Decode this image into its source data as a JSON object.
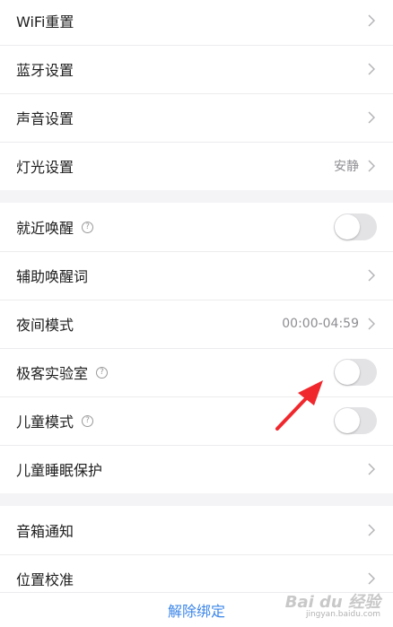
{
  "groups": [
    {
      "items": [
        {
          "label": "WiFi重置",
          "type": "link"
        },
        {
          "label": "蓝牙设置",
          "type": "link"
        },
        {
          "label": "声音设置",
          "type": "link"
        },
        {
          "label": "灯光设置",
          "type": "link",
          "value": "安静"
        }
      ]
    },
    {
      "items": [
        {
          "label": "就近唤醒",
          "type": "toggle",
          "help": true,
          "on": false
        },
        {
          "label": "辅助唤醒词",
          "type": "link"
        },
        {
          "label": "夜间模式",
          "type": "link",
          "value": "00:00-04:59"
        },
        {
          "label": "极客实验室",
          "type": "toggle",
          "help": true,
          "on": false
        },
        {
          "label": "儿童模式",
          "type": "toggle",
          "help": true,
          "on": false
        },
        {
          "label": "儿童睡眠保护",
          "type": "link"
        }
      ]
    },
    {
      "items": [
        {
          "label": "音箱通知",
          "type": "link"
        },
        {
          "label": "位置校准",
          "type": "link"
        }
      ]
    }
  ],
  "help_glyph": "?",
  "footer": {
    "unbind_label": "解除绑定"
  },
  "watermark": {
    "brand": "Bai du 经验",
    "site": "jingyan.baidu.com"
  },
  "colors": {
    "accent": "#3b86e8",
    "arrow": "#f0282d",
    "toggle_off": "#e3e3e6"
  },
  "icons": {
    "chevron": "chevron-right-icon",
    "help": "help-circle-icon",
    "annotation": "red-arrow-icon"
  }
}
